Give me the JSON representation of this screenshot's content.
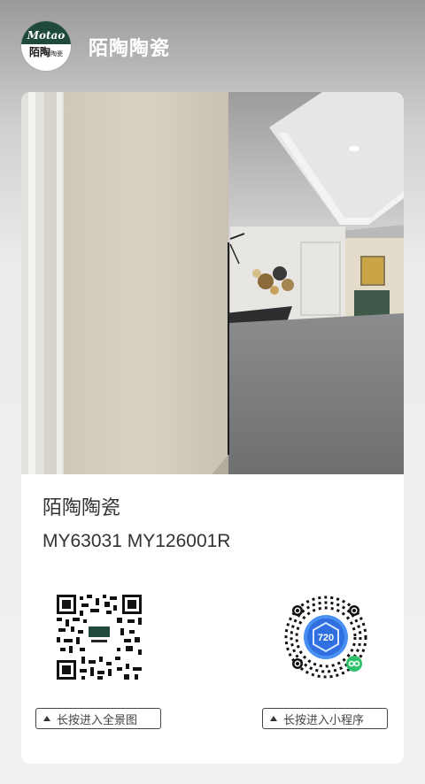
{
  "header": {
    "logo_text_top": "Motao",
    "logo_text_bottom": "陌陶",
    "logo_text_small": "陶瓷",
    "title": "陌陶陶瓷"
  },
  "card": {
    "title": "陌陶陶瓷",
    "subtitle": "MY63031 MY126001R",
    "qr_left_label": "长按进入全景图",
    "qr_right_label": "长按进入小程序",
    "mini_badge": "720"
  },
  "colors": {
    "brand_green": "#1f4a3a",
    "mini_blue": "#3a7bea",
    "mini_badge_green": "#2dc16a"
  }
}
